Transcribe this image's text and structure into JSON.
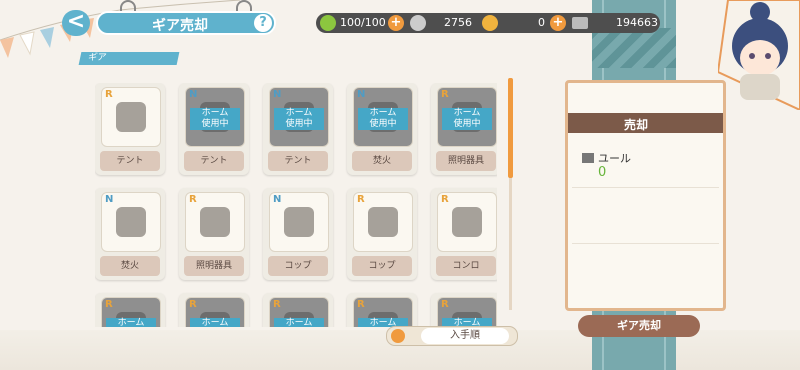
{
  "header": {
    "title": "ギア売却",
    "back_icon": "<",
    "help_icon": "?"
  },
  "resources": {
    "stamina": "100/100",
    "silver": "2756",
    "gold": "0",
    "yule_total": "194663"
  },
  "section_label": "ギア",
  "gear_items": [
    {
      "rarity": "R",
      "label": "テント",
      "in_use": false,
      "icon": "tent-icon"
    },
    {
      "rarity": "N",
      "label": "テント",
      "in_use": true,
      "icon": "tent-icon"
    },
    {
      "rarity": "N",
      "label": "テント",
      "in_use": true,
      "icon": "tent-icon"
    },
    {
      "rarity": "N",
      "label": "焚火",
      "in_use": true,
      "icon": "campfire-icon"
    },
    {
      "rarity": "R",
      "label": "照明器具",
      "in_use": true,
      "icon": "lantern-icon"
    },
    {
      "rarity": "N",
      "label": "焚火",
      "in_use": false,
      "icon": "campfire-icon"
    },
    {
      "rarity": "R",
      "label": "照明器具",
      "in_use": false,
      "icon": "lantern-icon"
    },
    {
      "rarity": "N",
      "label": "コップ",
      "in_use": false,
      "icon": "cup-icon"
    },
    {
      "rarity": "R",
      "label": "コップ",
      "in_use": false,
      "icon": "bottle-icon"
    },
    {
      "rarity": "R",
      "label": "コンロ",
      "in_use": false,
      "icon": "stove-icon"
    },
    {
      "rarity": "R",
      "label": "",
      "in_use": true,
      "icon": "gear-icon"
    },
    {
      "rarity": "R",
      "label": "",
      "in_use": true,
      "icon": "gear-icon"
    },
    {
      "rarity": "R",
      "label": "",
      "in_use": true,
      "icon": "gear-icon"
    },
    {
      "rarity": "R",
      "label": "",
      "in_use": true,
      "icon": "gear-icon"
    },
    {
      "rarity": "R",
      "label": "",
      "in_use": true,
      "icon": "gear-icon"
    }
  ],
  "in_use_text_line1": "ホーム",
  "in_use_text_line2": "使用中",
  "sort": {
    "label": "入手順"
  },
  "sell_panel": {
    "title": "売却",
    "currency_label": "ユール",
    "currency_value": "0",
    "button_label": "ギア売却"
  },
  "colors": {
    "accent": "#5fb2cd",
    "orange": "#f09a3e",
    "rarity_r": "#e8a33b",
    "rarity_n": "#4f9cc4"
  }
}
